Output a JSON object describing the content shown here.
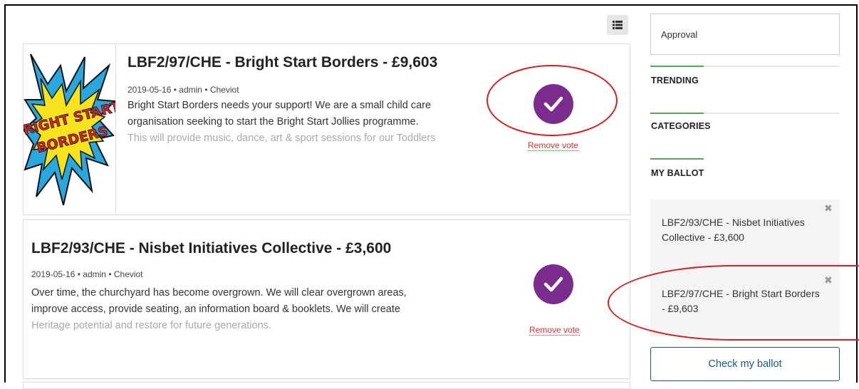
{
  "projects": [
    {
      "title": "LBF2/97/CHE - Bright Start Borders - £9,603",
      "date": "2019-05-16",
      "author": "admin",
      "area": "Cheviot",
      "desc_line1": "Bright Start Borders needs your support! We are a small child care",
      "desc_line2": "organisation seeking to start the Bright Start Jollies programme.",
      "desc_line3": "This will provide music, dance, art & sport sessions for our Toddlers",
      "remove_label": "Remove vote",
      "logo_text1": "BRIGHT START",
      "logo_text2": "BORDERS"
    },
    {
      "title": "LBF2/93/CHE - Nisbet Initiatives Collective - £3,600",
      "date": "2019-05-16",
      "author": "admin",
      "area": "Cheviot",
      "desc_line1": "Over time, the churchyard has become overgrown. We will clear overgrown areas,",
      "desc_line2": "improve access, provide seating, an information board & booklets. We will create",
      "desc_line3": "Heritage potential and restore for future generations.",
      "remove_label": "Remove vote"
    }
  ],
  "sidebar": {
    "voting_method": "Approval",
    "trending_title": "TRENDING",
    "categories_title": "CATEGORIES",
    "ballot_title": "MY BALLOT",
    "ballot_items": [
      "LBF2/93/CHE - Nisbet Initiatives Collective - £3,600",
      "LBF2/97/CHE - Bright Start Borders - £9,603"
    ],
    "check_ballot_label": "Check my ballot"
  },
  "colors": {
    "vote_purple": "#7b2d8e",
    "remove_red": "#d33333",
    "accent_green": "#4caf50",
    "annotation_red": "#d21f1f",
    "button_blue": "#1e5a78"
  },
  "icons": {
    "view_toggle": "list-view-icon",
    "vote": "check-icon",
    "remove": "close-icon"
  }
}
